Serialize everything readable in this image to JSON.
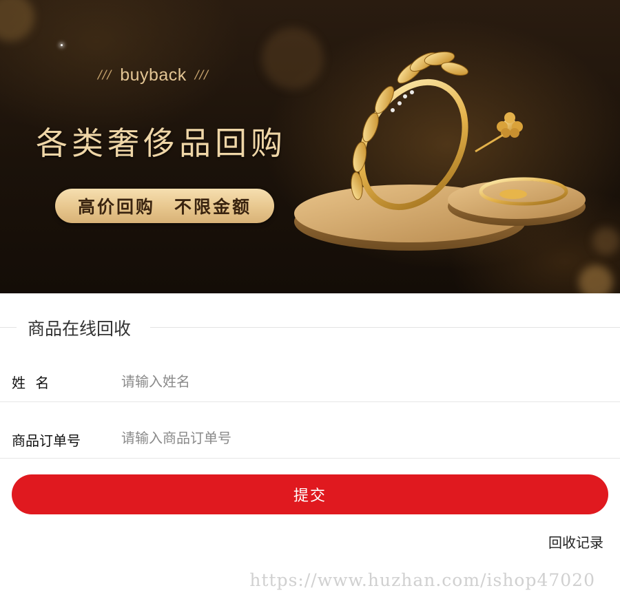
{
  "banner": {
    "tag": "buyback",
    "tag_decoration_left": "///",
    "tag_decoration_right": "///",
    "headline": "各类奢侈品回购",
    "pill_text": "高价回购　不限金额",
    "image": "gold-jewelry-ring-bracelet-illustration"
  },
  "form": {
    "section_title": "商品在线回收",
    "fields": [
      {
        "label": "姓 名",
        "placeholder": "请输入姓名",
        "value": ""
      },
      {
        "label": "商品订单号",
        "placeholder": "请输入商品订单号",
        "value": ""
      }
    ],
    "submit_label": "提交",
    "records_link": "回收记录"
  },
  "watermark": "https://www.huzhan.com/ishop47020",
  "colors": {
    "primary_button": "#e0191f",
    "banner_gold": "#efd6a7",
    "banner_bg": "#1b120a"
  }
}
